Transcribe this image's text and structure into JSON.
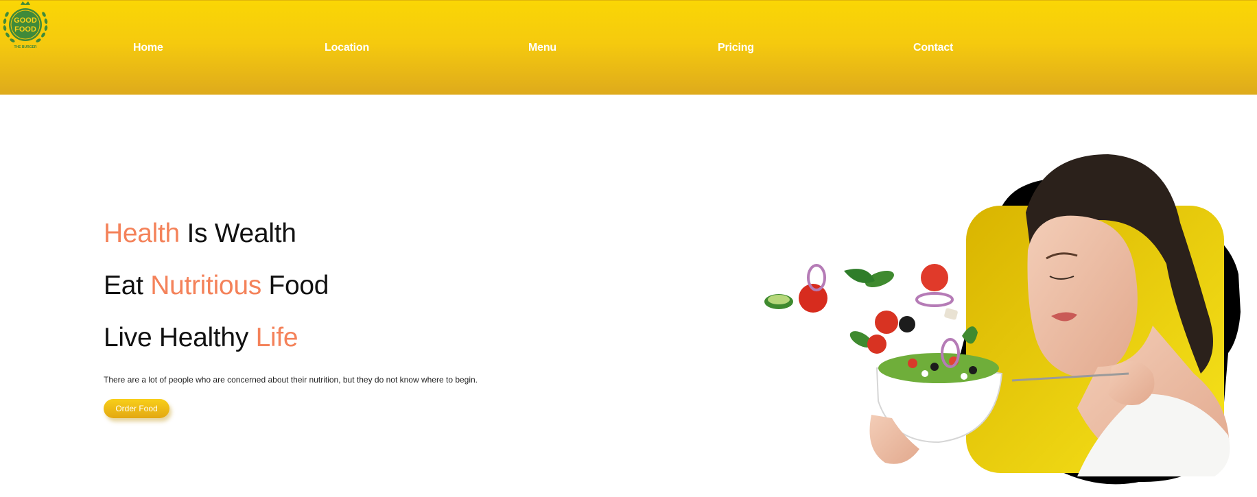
{
  "brand": {
    "logo_line1": "GOOD",
    "logo_line2": "FOOD",
    "logo_tagline": "THE BURGER"
  },
  "nav": {
    "home": "Home",
    "location": "Location",
    "menu": "Menu",
    "pricing": "Pricing",
    "contact": "Contact"
  },
  "hero": {
    "line1": {
      "accent": "Health",
      "rest": " Is Wealth"
    },
    "line2": {
      "start": "Eat ",
      "accent": "Nutritious",
      "end": " Food"
    },
    "line3": {
      "start": "Live Healthy ",
      "accent": "Life"
    },
    "description": "There are a lot of people who are concerned about their nutrition, but they do not know where to begin.",
    "cta_label": "Order Food"
  },
  "colors": {
    "header_top": "#fad605",
    "header_bottom": "#deaa1c",
    "accent": "#f4825a",
    "heading_text": "#111111",
    "button": "#f0bf16"
  },
  "icons": {
    "logo": "good-food-badge-logo",
    "hero_image": "woman-eating-salad-illustration"
  }
}
